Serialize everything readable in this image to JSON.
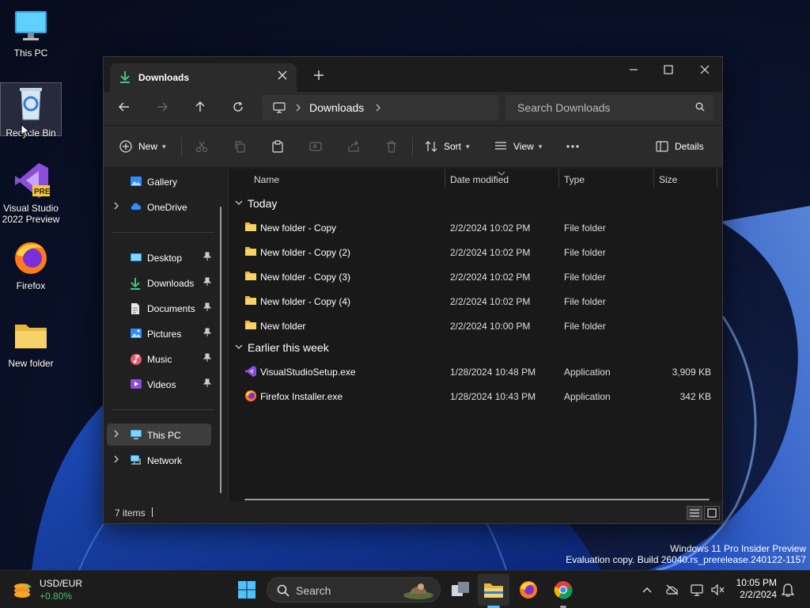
{
  "desktop": {
    "icons": [
      {
        "label": "This PC"
      },
      {
        "label": "Recycle Bin"
      },
      {
        "label_line1": "Visual Studio",
        "label_line2": "2022 Preview",
        "badge": "PRE"
      },
      {
        "label": "Firefox"
      },
      {
        "label": "New folder"
      }
    ],
    "watermark_line1": "Windows 11 Pro Insider Preview",
    "watermark_line2": "Evaluation copy. Build 26040.rs_prerelease.240122-1157"
  },
  "window": {
    "tab_title": "Downloads",
    "address": {
      "crumb": "Downloads"
    },
    "search_placeholder": "Search Downloads",
    "toolbar": {
      "new_label": "New",
      "sort_label": "Sort",
      "view_label": "View",
      "details_label": "Details"
    },
    "nav": {
      "top_items": [
        {
          "label": "Gallery",
          "icon": "gallery-icon"
        },
        {
          "label": "OneDrive",
          "icon": "cloud-icon"
        }
      ],
      "pinned": [
        {
          "label": "Desktop",
          "icon": "desktop-icon"
        },
        {
          "label": "Downloads",
          "icon": "download-icon"
        },
        {
          "label": "Documents",
          "icon": "document-icon"
        },
        {
          "label": "Pictures",
          "icon": "picture-icon"
        },
        {
          "label": "Music",
          "icon": "music-icon"
        },
        {
          "label": "Videos",
          "icon": "video-icon"
        }
      ],
      "bottom_items": [
        {
          "label": "This PC",
          "icon": "computer-icon",
          "selected": true
        },
        {
          "label": "Network",
          "icon": "network-icon"
        }
      ]
    },
    "columns": {
      "name": "Name",
      "date": "Date modified",
      "type": "Type",
      "size": "Size"
    },
    "groups": [
      {
        "label": "Today",
        "rows": [
          {
            "name": "New folder - Copy",
            "date": "2/2/2024 10:02 PM",
            "type": "File folder",
            "size": ""
          },
          {
            "name": "New folder - Copy (2)",
            "date": "2/2/2024 10:02 PM",
            "type": "File folder",
            "size": ""
          },
          {
            "name": "New folder - Copy (3)",
            "date": "2/2/2024 10:02 PM",
            "type": "File folder",
            "size": ""
          },
          {
            "name": "New folder - Copy (4)",
            "date": "2/2/2024 10:02 PM",
            "type": "File folder",
            "size": ""
          },
          {
            "name": "New folder",
            "date": "2/2/2024 10:00 PM",
            "type": "File folder",
            "size": ""
          }
        ]
      },
      {
        "label": "Earlier this week",
        "rows": [
          {
            "name": "VisualStudioSetup.exe",
            "date": "1/28/2024 10:48 PM",
            "type": "Application",
            "size": "3,909 KB"
          },
          {
            "name": "Firefox Installer.exe",
            "date": "1/28/2024 10:43 PM",
            "type": "Application",
            "size": "342 KB"
          }
        ]
      }
    ],
    "status": "7 items"
  },
  "taskbar": {
    "widget_title": "USD/EUR",
    "widget_value": "+0.80%",
    "search_label": "Search",
    "time": "10:05 PM",
    "date": "2/2/2024"
  },
  "colors": {
    "accent": "#60cdff",
    "folder": "#f5c542",
    "positive": "#44c26d"
  }
}
